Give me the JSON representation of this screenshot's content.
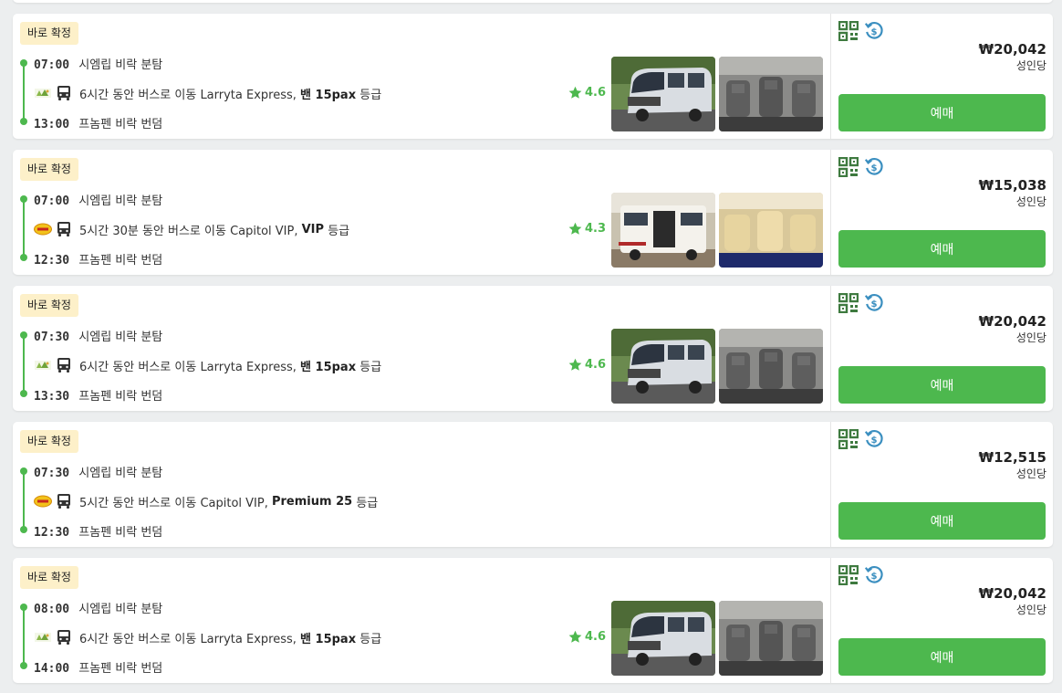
{
  "trips": [
    {
      "badge": "바로 확정",
      "dep_time": "07:00",
      "dep_place": "시엠립 비락 분탐",
      "arr_time": "13:00",
      "arr_place": "프놈펜 비락 번덤",
      "duration_text": "6시간 동안 버스로 이동 Larryta Express,",
      "class_name": "밴 15pax",
      "class_suffix": "등급",
      "operator_logo": "larryta-logo",
      "rating": "4.6",
      "price": "₩20,042",
      "per_person": "성인당",
      "book_label": "예매",
      "photos": [
        "van-exterior-photo",
        "van-interior-photo"
      ]
    },
    {
      "badge": "바로 확정",
      "dep_time": "07:00",
      "dep_place": "시엠립 비락 분탐",
      "arr_time": "12:30",
      "arr_place": "프놈펜 비락 번덤",
      "duration_text": "5시간 30분 동안 버스로 이동 Capitol VIP,",
      "class_name": "VIP",
      "class_suffix": "등급",
      "operator_logo": "capitol-logo",
      "rating": "4.3",
      "price": "₩15,038",
      "per_person": "성인당",
      "book_label": "예매",
      "photos": [
        "van-exterior-photo",
        "van-interior-photo"
      ]
    },
    {
      "badge": "바로 확정",
      "dep_time": "07:30",
      "dep_place": "시엠립 비락 분탐",
      "arr_time": "13:30",
      "arr_place": "프놈펜 비락 번덤",
      "duration_text": "6시간 동안 버스로 이동 Larryta Express,",
      "class_name": "밴 15pax",
      "class_suffix": "등급",
      "operator_logo": "larryta-logo",
      "rating": "4.6",
      "price": "₩20,042",
      "per_person": "성인당",
      "book_label": "예매",
      "photos": [
        "van-exterior-photo",
        "van-interior-photo"
      ]
    },
    {
      "badge": "바로 확정",
      "dep_time": "07:30",
      "dep_place": "시엠립 비락 분탐",
      "arr_time": "12:30",
      "arr_place": "프놈펜 비락 번덤",
      "duration_text": "5시간 동안 버스로 이동 Capitol VIP,",
      "class_name": "Premium 25",
      "class_suffix": "등급",
      "operator_logo": "capitol-logo",
      "rating": "",
      "price": "₩12,515",
      "per_person": "성인당",
      "book_label": "예매",
      "photos": []
    },
    {
      "badge": "바로 확정",
      "dep_time": "08:00",
      "dep_place": "시엠립 비락 분탐",
      "arr_time": "14:00",
      "arr_place": "프놈펜 비락 번덤",
      "duration_text": "6시간 동안 버스로 이동 Larryta Express,",
      "class_name": "밴 15pax",
      "class_suffix": "등급",
      "operator_logo": "larryta-logo",
      "rating": "4.6",
      "price": "₩20,042",
      "per_person": "성인당",
      "book_label": "예매",
      "photos": [
        "van-exterior-photo",
        "van-interior-photo"
      ]
    }
  ],
  "colors": {
    "accent": "#4db84e",
    "badge_bg": "#fdf0c9",
    "qr_icon": "#3e7a3f",
    "refund_icon": "#3b8fc0"
  },
  "icons": [
    "qr-code-icon",
    "refund-icon",
    "bus-icon",
    "star-icon"
  ]
}
